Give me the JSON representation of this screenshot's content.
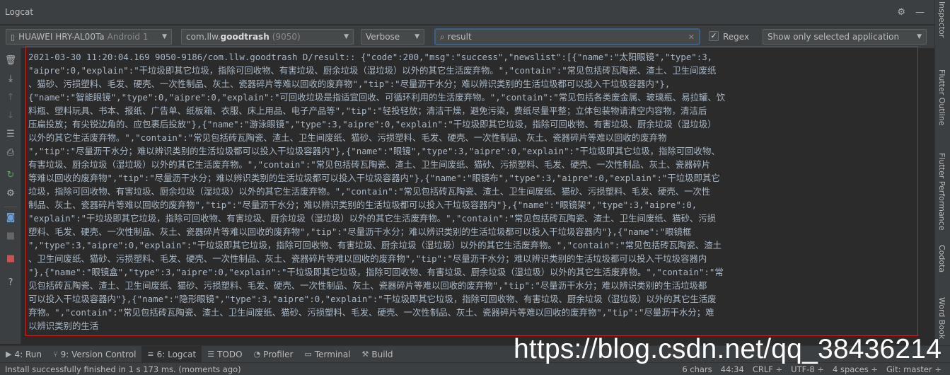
{
  "window": {
    "title": "Logcat"
  },
  "toolbar": {
    "device": {
      "name": "HUAWEI HRY-AL00Ta",
      "os": "Android 1"
    },
    "process": {
      "prefix": "com.llw.",
      "bold": "goodtrash",
      "pid": "(9050)"
    },
    "log_level": "Verbose",
    "search": {
      "value": "result",
      "placeholder": ""
    },
    "regex": {
      "checked": true,
      "label": "Regex"
    },
    "filter": "Show only selected application"
  },
  "log": {
    "text": "2021-03-30 11:20:04.169 9050-9186/com.llw.goodtrash D/result:: {\"code\":200,\"msg\":\"success\",\"newslist\":[{\"name\":\"太阳眼镜\",\"type\":3,\n\"aipre\":0,\"explain\":\"干垃圾即其它垃圾，指除可回收物、有害垃圾、厨余垃圾（湿垃圾）以外的其它生活废弃物。\",\"contain\":\"常见包括砖瓦陶瓷、渣土、卫生间废纸\n、猫砂、污损塑料、毛发、硬壳、一次性制品、灰土、瓷器碎片等难以回收的废弃物\",\"tip\":\"尽量沥干水分；难以辨识类别的生活垃圾都可以投入干垃圾容器内\"},\n{\"name\":\"智能眼镜\",\"type\":0,\"aipre\":0,\"explain\":\"可回收垃圾是指适宜回收、可循环利用的生活废弃物。\",\"contain\":\"常见包括各类废金属、玻璃瓶、易拉罐、饮\n料瓶、塑料玩具、书本、报纸、广告单、纸板箱、衣服、床上用品、电子产品等\",\"tip\":\"轻投轻放；清洁干燥，避免污染，费纸尽量平整；立体包装物请清空内容物，清洁后\n压扁投放；有尖锐边角的、应包裹后投放\"},{\"name\":\"游泳眼镜\",\"type\":3,\"aipre\":0,\"explain\":\"干垃圾即其它垃圾，指除可回收物、有害垃圾、厨余垃圾（湿垃圾）\n以外的其它生活废弃物。\",\"contain\":\"常见包括砖瓦陶瓷、渣土、卫生间废纸、猫砂、污损塑料、毛发、硬壳、一次性制品、灰土、瓷器碎片等难以回收的废弃物\n\",\"tip\":\"尽量沥干水分；难以辨识类别的生活垃圾都可以投入干垃圾容器内\"},{\"name\":\"眼镜\",\"type\":3,\"aipre\":0,\"explain\":\"干垃圾即其它垃圾，指除可回收物、\n有害垃圾、厨余垃圾（湿垃圾）以外的其它生活废弃物。\",\"contain\":\"常见包括砖瓦陶瓷、渣土、卫生间废纸、猫砂、污损塑料、毛发、硬壳、一次性制品、灰土、瓷器碎片\n等难以回收的废弃物\",\"tip\":\"尽量沥干水分；难以辨识类别的生活垃圾都可以投入干垃圾容器内\"},{\"name\":\"眼镜布\",\"type\":3,\"aipre\":0,\"explain\":\"干垃圾即其它\n垃圾，指除可回收物、有害垃圾、厨余垃圾（湿垃圾）以外的其它生活废弃物。\",\"contain\":\"常见包括砖瓦陶瓷、渣土、卫生间废纸、猫砂、污损塑料、毛发、硬壳、一次性\n制品、灰土、瓷器碎片等难以回收的废弃物\",\"tip\":\"尽量沥干水分；难以辨识类别的生活垃圾都可以投入干垃圾容器内\"},{\"name\":\"眼镜架\",\"type\":3,\"aipre\":0,\n\"explain\":\"干垃圾即其它垃圾，指除可回收物、有害垃圾、厨余垃圾（湿垃圾）以外的其它生活废弃物。\",\"contain\":\"常见包括砖瓦陶瓷、渣土、卫生间废纸、猫砂、污损\n塑料、毛发、硬壳、一次性制品、灰土、瓷器碎片等难以回收的废弃物\",\"tip\":\"尽量沥干水分；难以辨识类别的生活垃圾都可以投入干垃圾容器内\"},{\"name\":\"眼镜框\n\",\"type\":3,\"aipre\":0,\"explain\":\"干垃圾即其它垃圾，指除可回收物、有害垃圾、厨余垃圾（湿垃圾）以外的其它生活废弃物。\",\"contain\":\"常见包括砖瓦陶瓷、渣土\n、卫生间废纸、猫砂、污损塑料、毛发、硬壳、一次性制品、灰土、瓷器碎片等难以回收的废弃物\",\"tip\":\"尽量沥干水分；难以辨识类别的生活垃圾都可以投入干垃圾容器内\n\"},{\"name\":\"眼镜盒\",\"type\":3,\"aipre\":0,\"explain\":\"干垃圾即其它垃圾，指除可回收物、有害垃圾、厨余垃圾（湿垃圾）以外的其它生活废弃物。\",\"contain\":\"常\n见包括砖瓦陶瓷、渣土、卫生间废纸、猫砂、污损塑料、毛发、硬壳、一次性制品、灰土、瓷器碎片等难以回收的废弃物\",\"tip\":\"尽量沥干水分；难以辨识类别的生活垃圾都\n可以投入干垃圾容器内\"},{\"name\":\"隐形眼镜\",\"type\":3,\"aipre\":0,\"explain\":\"干垃圾即其它垃圾，指除可回收物、有害垃圾、厨余垃圾（湿垃圾）以外的其它生活废\n弃物。\",\"contain\":\"常见包括砖瓦陶瓷、渣土、卫生间废纸、猫砂、污损塑料、毛发、硬壳、一次性制品、灰土、瓷器碎片等难以回收的废弃物\",\"tip\":\"尽量沥干水分；难\n以辨识类别的生活"
  },
  "right_tabs": [
    "Inspector",
    "Flutter Outline",
    "Flutter Performance",
    "Codota",
    "Word Book"
  ],
  "tool_windows": [
    {
      "label": "4: Run",
      "icon": "run-icon"
    },
    {
      "label": "9: Version Control",
      "icon": "vcs-icon"
    },
    {
      "label": "6: Logcat",
      "icon": "logcat-icon",
      "active": true
    },
    {
      "label": "TODO",
      "icon": "todo-icon"
    },
    {
      "label": "Profiler",
      "icon": "profiler-icon"
    },
    {
      "label": "Terminal",
      "icon": "terminal-icon"
    },
    {
      "label": "Build",
      "icon": "build-icon"
    }
  ],
  "status": {
    "message": "Install successfully finished in 1 s 173 ms. (moments ago)",
    "chars": "6 chars",
    "position": "44:34",
    "line_sep": "CRLF ÷",
    "encoding": "UTF-8 ÷",
    "indent": "4 spaces ÷",
    "vcs": "Git: master ÷"
  },
  "watermark": "https://blog.csdn.net/qq_38436214",
  "colors": {
    "highlight": "#cc2222",
    "background": "#2b2b2b",
    "panel": "#3c3f41",
    "log_text": "#a9b7c6"
  }
}
